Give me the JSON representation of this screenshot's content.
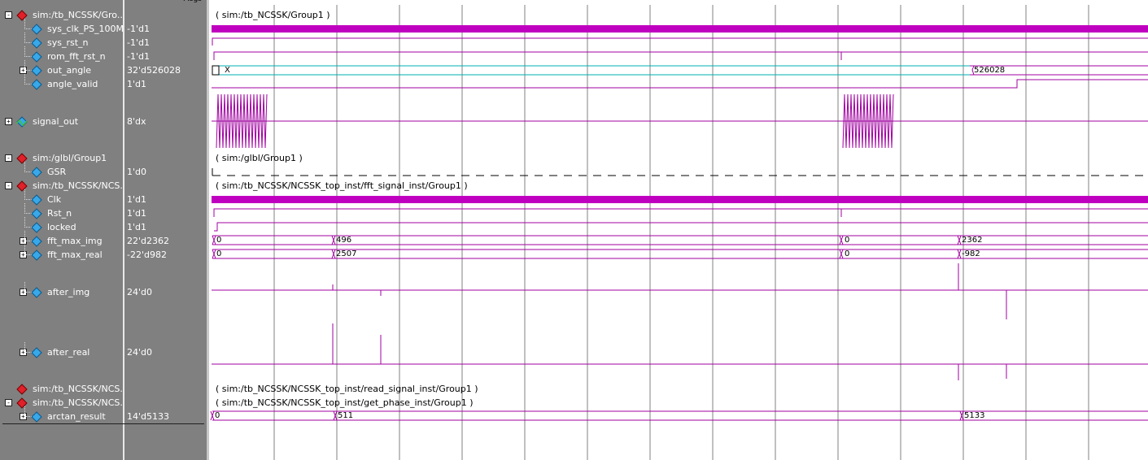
{
  "colors": {
    "wave": "#a000a0",
    "clock_fill": "#c000c0",
    "analog_x": "#00b0b0",
    "panel": "#808080"
  },
  "signals": [
    {
      "name": "sim:/tb_NCSSK/Gro...",
      "value": "",
      "icon": "group-diamond-icon"
    },
    {
      "name": "sys_clk_PS_100M",
      "value": "-1'd1",
      "icon": "signal-diamond-icon"
    },
    {
      "name": "sys_rst_n",
      "value": "-1'd1",
      "icon": "signal-diamond-icon"
    },
    {
      "name": "rom_fft_rst_n",
      "value": "-1'd1",
      "icon": "signal-diamond-icon"
    },
    {
      "name": "out_angle",
      "value": "32'd526028",
      "icon": "signal-diamond-icon"
    },
    {
      "name": "angle_valid",
      "value": "1'd1",
      "icon": "signal-diamond-icon"
    },
    {
      "name": "signal_out",
      "value": "8'dx",
      "icon": "analog-signal-icon"
    },
    {
      "name": "sim:/glbl/Group1",
      "value": "",
      "icon": "group-diamond-icon"
    },
    {
      "name": "GSR",
      "value": "1'd0",
      "icon": "signal-diamond-icon"
    },
    {
      "name": "sim:/tb_NCSSK/NCS...",
      "value": "",
      "icon": "group-diamond-icon"
    },
    {
      "name": "Clk",
      "value": "1'd1",
      "icon": "signal-diamond-icon"
    },
    {
      "name": "Rst_n",
      "value": "1'd1",
      "icon": "signal-diamond-icon"
    },
    {
      "name": "locked",
      "value": "1'd1",
      "icon": "signal-diamond-icon"
    },
    {
      "name": "fft_max_img",
      "value": "22'd2362",
      "icon": "signal-diamond-icon"
    },
    {
      "name": "fft_max_real",
      "value": "-22'd982",
      "icon": "signal-diamond-icon"
    },
    {
      "name": "after_img",
      "value": "24'd0",
      "icon": "signal-diamond-icon"
    },
    {
      "name": "after_real",
      "value": "24'd0",
      "icon": "signal-diamond-icon"
    },
    {
      "name": "sim:/tb_NCSSK/NCS...",
      "value": "",
      "icon": "group-diamond-icon"
    },
    {
      "name": "sim:/tb_NCSSK/NCS...",
      "value": "",
      "icon": "group-diamond-icon"
    },
    {
      "name": "arctan_result",
      "value": "14'd5133",
      "icon": "signal-diamond-icon"
    }
  ],
  "group_titles": [
    "( sim:/tb_NCSSK/Group1 )",
    "( sim:/glbl/Group1 )",
    "( sim:/tb_NCSSK/NCSSK_top_inst/fft_signal_inst/Group1 )",
    "( sim:/tb_NCSSK/NCSSK_top_inst/read_signal_inst/Group1 )",
    "( sim:/tb_NCSSK/NCSSK_top_inst/get_phase_inst/Group1 )"
  ],
  "bus_values": {
    "out_angle": [
      "X",
      "526028"
    ],
    "fft_max_img": [
      "0",
      "496",
      "0",
      "2362"
    ],
    "fft_max_real": [
      "0",
      "2507",
      "0",
      "-982"
    ],
    "arctan_result": [
      "0",
      "511",
      "5133"
    ]
  },
  "header_fragment": "Msgs"
}
